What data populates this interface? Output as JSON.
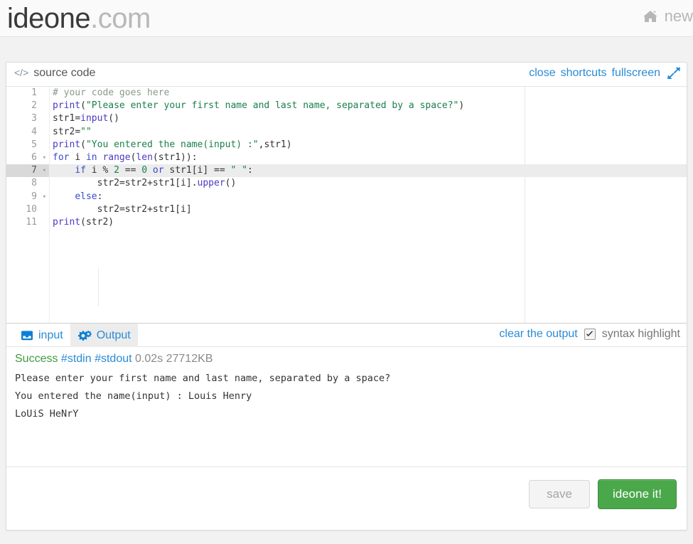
{
  "header": {
    "logo_main": "ideone",
    "logo_tld": ".com",
    "home_icon": "home-icon",
    "nav_label": "new"
  },
  "source_panel": {
    "title": "source code",
    "code_glyph": "</>",
    "actions": {
      "close": "close",
      "shortcuts": "shortcuts",
      "fullscreen": "fullscreen",
      "fullscreen_icon": "expand-diagonal-icon"
    }
  },
  "editor": {
    "active_line": 7,
    "cursor_line": 7,
    "lines": [
      {
        "n": "1",
        "fold": false,
        "text": "# your code goes here"
      },
      {
        "n": "2",
        "fold": false,
        "text": "print(\"Please enter your first name and last name, separated by a space?\")"
      },
      {
        "n": "3",
        "fold": false,
        "text": "str1=input()"
      },
      {
        "n": "4",
        "fold": false,
        "text": "str2=\"\""
      },
      {
        "n": "5",
        "fold": false,
        "text": "print(\"You entered the name(input) :\",str1)"
      },
      {
        "n": "6",
        "fold": true,
        "text": "for i in range(len(str1)):"
      },
      {
        "n": "7",
        "fold": true,
        "text": "    if i % 2 == 0 or str1[i] == \" \":"
      },
      {
        "n": "8",
        "fold": false,
        "text": "        str2=str2+str1[i].upper()"
      },
      {
        "n": "9",
        "fold": true,
        "text": "    else:"
      },
      {
        "n": "10",
        "fold": false,
        "text": "        str2=str2+str1[i]"
      },
      {
        "n": "11",
        "fold": false,
        "text": "print(str2)"
      }
    ],
    "fold_glyph": "▾"
  },
  "io_panel": {
    "tabs": [
      {
        "label": "input",
        "icon": "inbox-icon",
        "active": false
      },
      {
        "label": "Output",
        "icon": "gears-icon",
        "active": true
      }
    ],
    "clear_link": "clear the output",
    "syntax_highlight_label": "syntax highlight",
    "syntax_highlight_checked": true,
    "check_icon": "check-mark-icon",
    "status": {
      "result": "Success",
      "stdin": "#stdin",
      "stdout": "#stdout",
      "time": "0.02s",
      "memory": "27712KB"
    },
    "output_lines": [
      "Please enter your first name and last name, separated by a space?",
      "You entered the name(input) : Louis Henry",
      "LoUiS HeNrY"
    ]
  },
  "footer": {
    "save_label": "save",
    "run_label": "ideone it!"
  },
  "colors": {
    "accent_blue": "#2a8bd5",
    "success_green": "#3f9a3f",
    "run_button_green": "#4aa74a",
    "string_green": "#1a7f4b",
    "keyword_blue": "#3b4bc8"
  }
}
